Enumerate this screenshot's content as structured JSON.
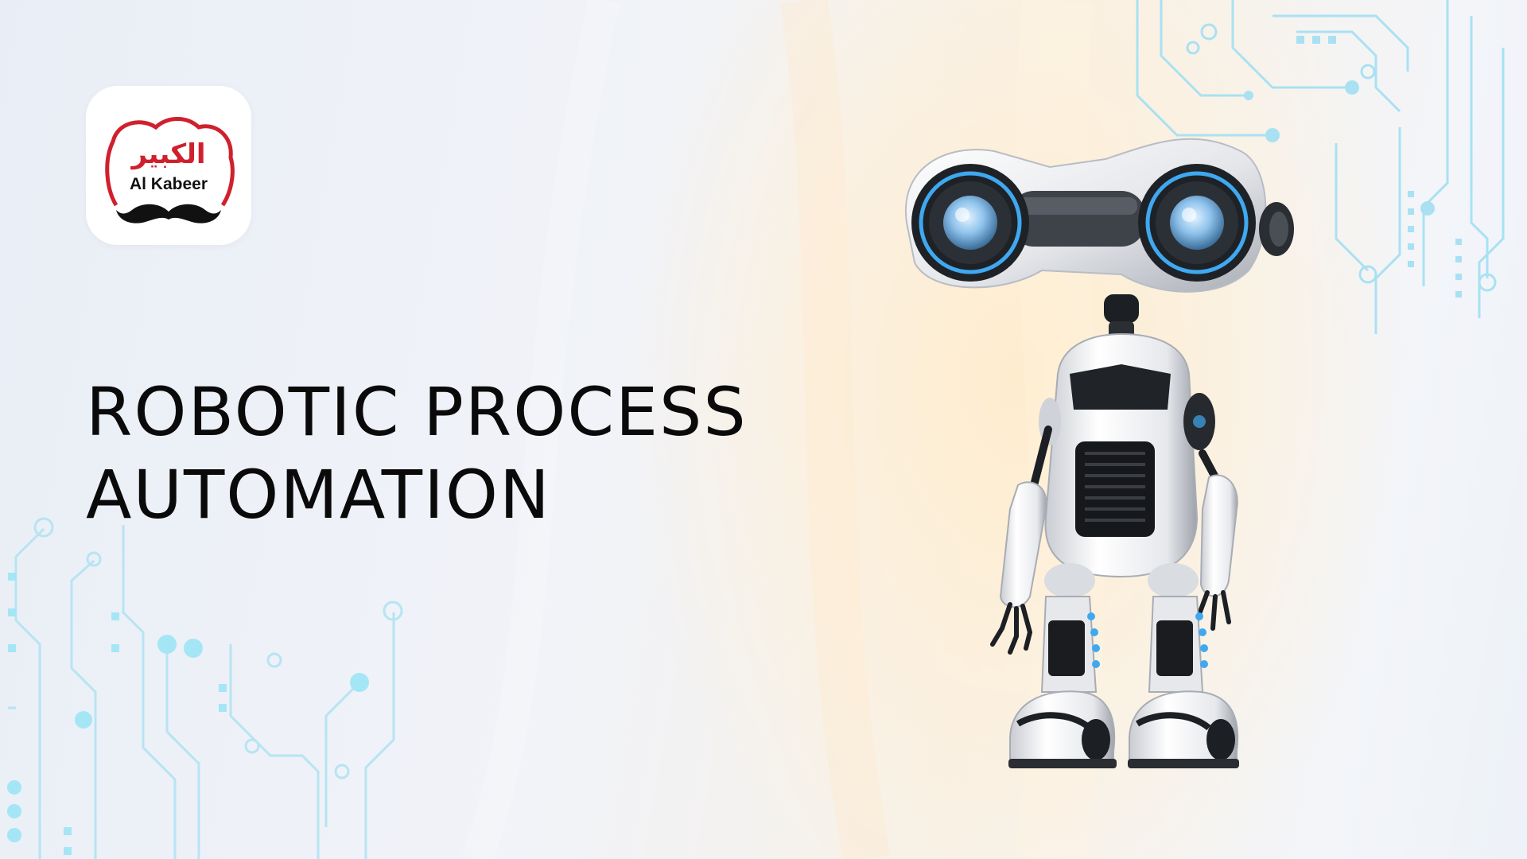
{
  "brand": {
    "arabic_name": "الكبير",
    "latin_name": "Al Kabeer",
    "accent_color": "#d0202d",
    "logo_icon": "chef-hat-mustache-icon"
  },
  "headline": {
    "line1": "ROBOTIC PROCESS",
    "line2": "AUTOMATION"
  },
  "illustration": {
    "subject": "robot-icon",
    "circuit_color": "#8fd6f0"
  }
}
